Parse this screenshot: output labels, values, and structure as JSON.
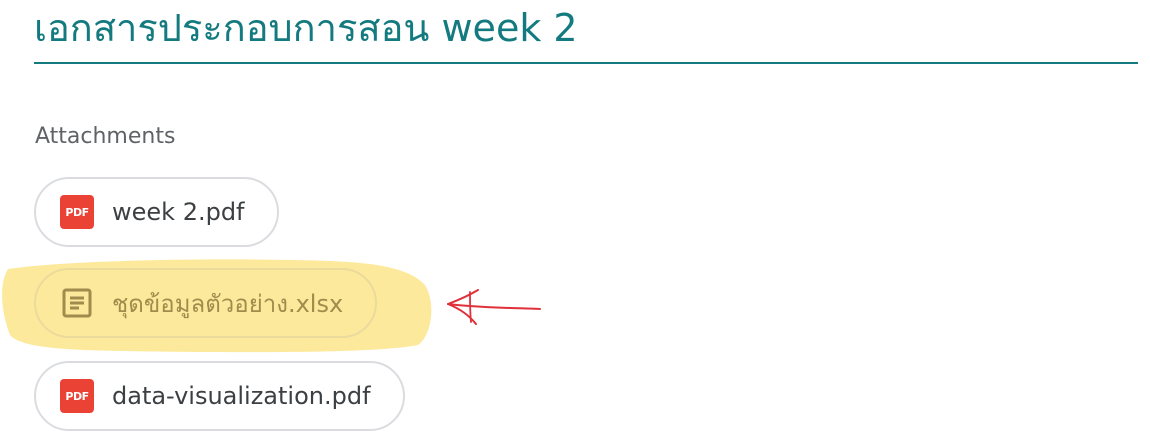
{
  "page": {
    "title": "เอกสารประกอบการสอน week 2"
  },
  "attachments": {
    "label": "Attachments",
    "items": [
      {
        "name": "week 2.pdf",
        "type_icon": "pdf-icon",
        "icon_text": "PDF"
      },
      {
        "name": "ชุดข้อมูลตัวอย่าง.xlsx",
        "type_icon": "document-icon"
      },
      {
        "name": "data-visualization.pdf",
        "type_icon": "pdf-icon",
        "icon_text": "PDF"
      }
    ]
  },
  "colors": {
    "title": "#137a7f",
    "pdf_icon": "#ea4335",
    "highlight": "#fde58a",
    "annotation_arrow": "#e0303a"
  }
}
